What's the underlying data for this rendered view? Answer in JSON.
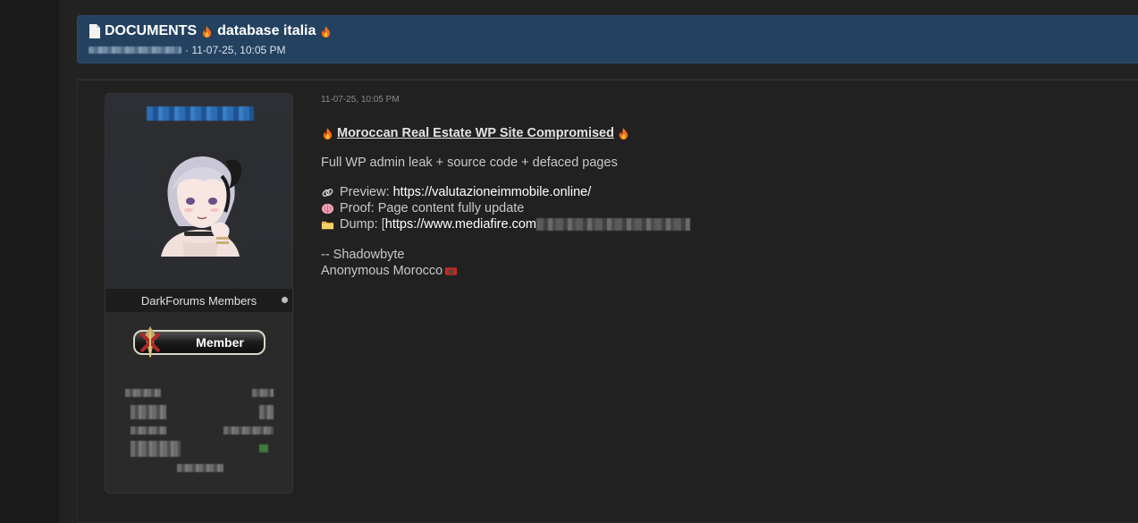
{
  "thread": {
    "title": "DOCUMENTS 🔥 database italia 🔥",
    "title_prefix": "DOCUMENTS",
    "title_main": "database italia",
    "date": "· 11-07-25, 10:05 PM"
  },
  "author": {
    "group": "DarkForums Members",
    "rank_label": "Member"
  },
  "post": {
    "date": "11-07-25, 10:05 PM",
    "heading": "Moroccan Real Estate WP Site Compromised",
    "summary": "Full WP admin leak + source code + defaced pages",
    "preview_label": "Preview:",
    "preview_url": "https://valutazioneimmobile.online/",
    "proof_text": "Proof: Page content fully update",
    "dump_label": "Dump: [",
    "dump_url": "https://www.mediafire.com",
    "sign_1": "-- Shadowbyte",
    "sign_2": "Anonymous Morocco"
  },
  "colors": {
    "header_bg": "#24415f",
    "page_bg": "#222222",
    "card_bg": "#2a2a2a",
    "link": "#ffffff"
  },
  "icons": {
    "title": "document-icon",
    "fire": "fire-icon",
    "preview": "link-icon",
    "proof": "brain-icon",
    "dump": "folder-icon",
    "flag": "flag-icon"
  }
}
